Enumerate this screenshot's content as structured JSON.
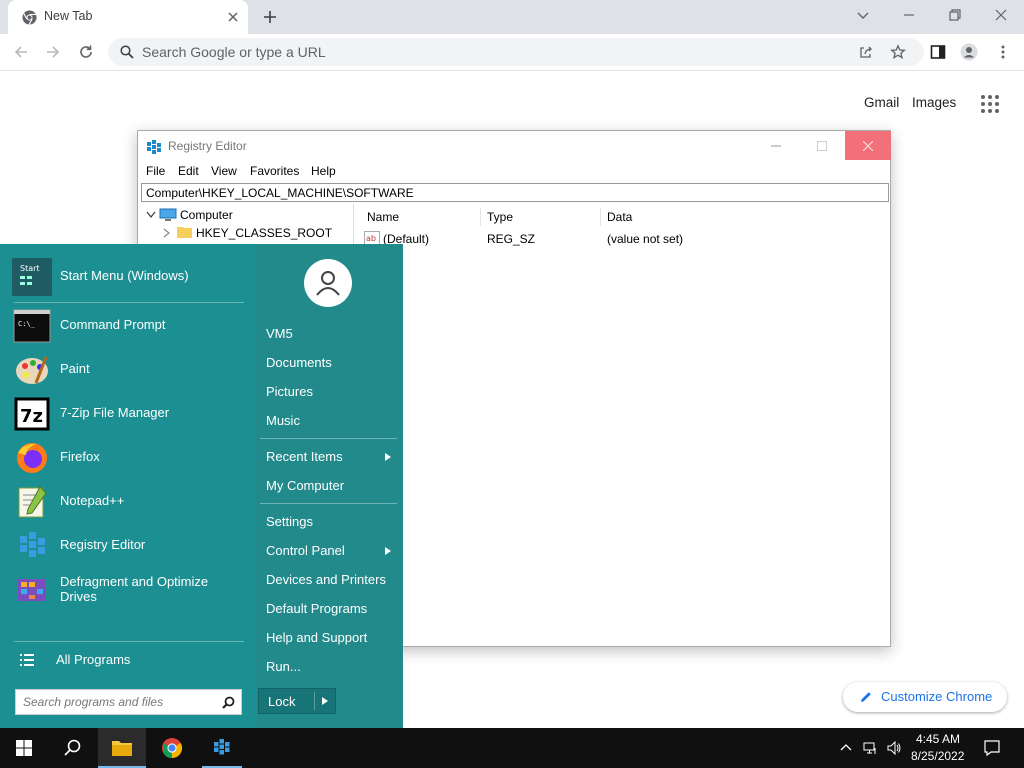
{
  "browser": {
    "tab_title": "New Tab",
    "omnibox_placeholder": "Search Google or type a URL",
    "links": {
      "gmail": "Gmail",
      "images": "Images"
    },
    "customize_label": "Customize Chrome"
  },
  "regedit": {
    "title": "Registry Editor",
    "menu": [
      "File",
      "Edit",
      "View",
      "Favorites",
      "Help"
    ],
    "address": "Computer\\HKEY_LOCAL_MACHINE\\SOFTWARE",
    "tree": {
      "root": "Computer",
      "child": "HKEY_CLASSES_ROOT"
    },
    "columns": [
      "Name",
      "Type",
      "Data"
    ],
    "rows": [
      {
        "name": "(Default)",
        "type": "REG_SZ",
        "data": "(value not set)"
      }
    ]
  },
  "startmenu": {
    "programs": [
      {
        "label": "Start Menu (Windows)",
        "icon": "start-menu-icon"
      },
      {
        "label": "Command Prompt",
        "icon": "command-prompt-icon"
      },
      {
        "label": "Paint",
        "icon": "paint-icon"
      },
      {
        "label": "7-Zip File Manager",
        "icon": "7zip-icon"
      },
      {
        "label": "Firefox",
        "icon": "firefox-icon"
      },
      {
        "label": "Notepad++",
        "icon": "notepadpp-icon"
      },
      {
        "label": "Registry Editor",
        "icon": "registry-editor-icon"
      },
      {
        "label": "Defragment and Optimize Drives",
        "icon": "defrag-icon"
      }
    ],
    "start_icon_text": "Start",
    "all_programs": "All Programs",
    "search_placeholder": "Search programs and files",
    "right": [
      {
        "label": "VM5"
      },
      {
        "label": "Documents"
      },
      {
        "label": "Pictures"
      },
      {
        "label": "Music"
      },
      {
        "label": "Recent Items",
        "submenu": true
      },
      {
        "label": "My Computer"
      },
      {
        "label": "Settings"
      },
      {
        "label": "Control Panel",
        "submenu": true
      },
      {
        "label": "Devices and Printers"
      },
      {
        "label": "Default Programs"
      },
      {
        "label": "Help and Support"
      },
      {
        "label": "Run..."
      }
    ],
    "lock_label": "Lock"
  },
  "taskbar": {
    "time": "4:45 AM",
    "date": "8/25/2022"
  },
  "colors": {
    "startmenu_bg": "#238a8c",
    "close_hover": "#f1707a",
    "link_blue": "#1a73e8"
  }
}
